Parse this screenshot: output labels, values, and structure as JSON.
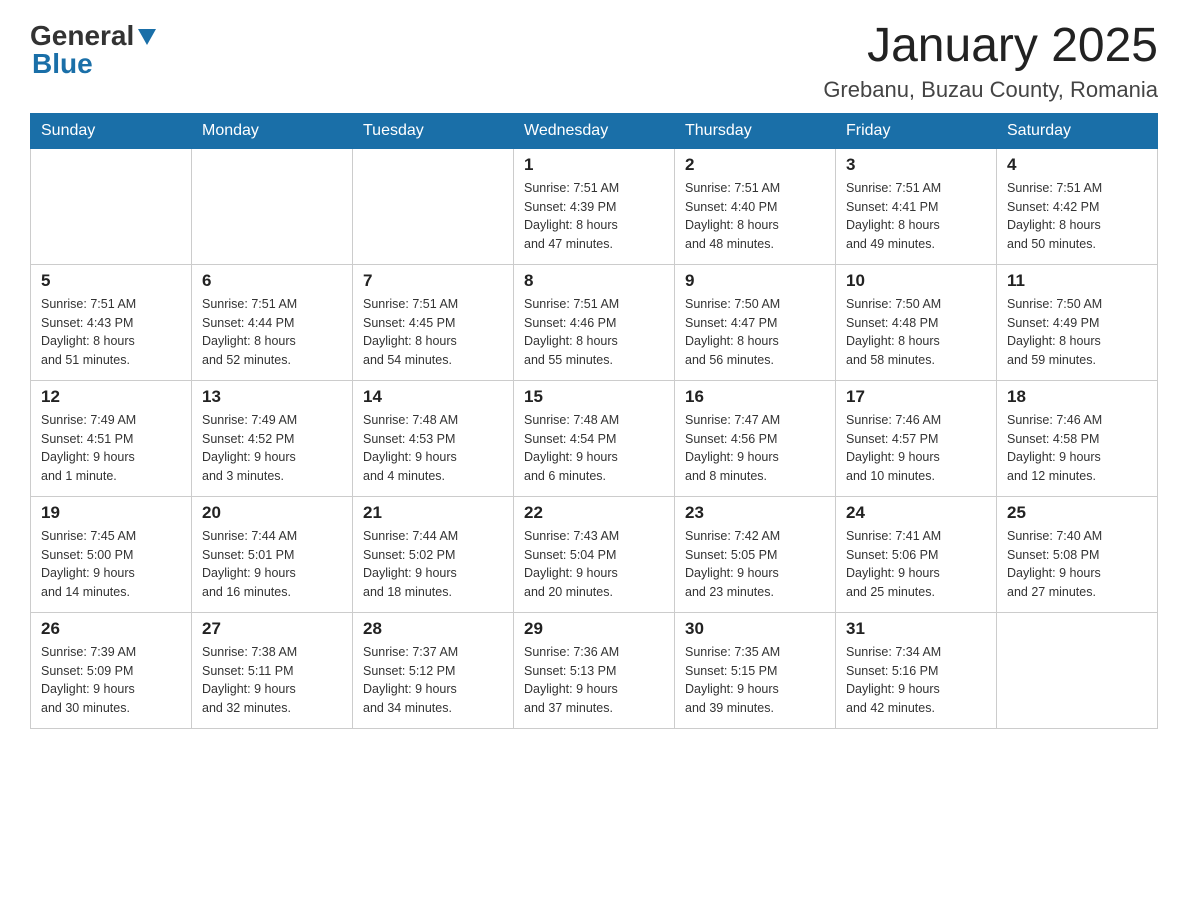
{
  "header": {
    "logo": {
      "general": "General",
      "blue": "Blue"
    },
    "title": "January 2025",
    "location": "Grebanu, Buzau County, Romania"
  },
  "weekdays": [
    "Sunday",
    "Monday",
    "Tuesday",
    "Wednesday",
    "Thursday",
    "Friday",
    "Saturday"
  ],
  "weeks": [
    [
      {
        "day": "",
        "info": ""
      },
      {
        "day": "",
        "info": ""
      },
      {
        "day": "",
        "info": ""
      },
      {
        "day": "1",
        "info": "Sunrise: 7:51 AM\nSunset: 4:39 PM\nDaylight: 8 hours\nand 47 minutes."
      },
      {
        "day": "2",
        "info": "Sunrise: 7:51 AM\nSunset: 4:40 PM\nDaylight: 8 hours\nand 48 minutes."
      },
      {
        "day": "3",
        "info": "Sunrise: 7:51 AM\nSunset: 4:41 PM\nDaylight: 8 hours\nand 49 minutes."
      },
      {
        "day": "4",
        "info": "Sunrise: 7:51 AM\nSunset: 4:42 PM\nDaylight: 8 hours\nand 50 minutes."
      }
    ],
    [
      {
        "day": "5",
        "info": "Sunrise: 7:51 AM\nSunset: 4:43 PM\nDaylight: 8 hours\nand 51 minutes."
      },
      {
        "day": "6",
        "info": "Sunrise: 7:51 AM\nSunset: 4:44 PM\nDaylight: 8 hours\nand 52 minutes."
      },
      {
        "day": "7",
        "info": "Sunrise: 7:51 AM\nSunset: 4:45 PM\nDaylight: 8 hours\nand 54 minutes."
      },
      {
        "day": "8",
        "info": "Sunrise: 7:51 AM\nSunset: 4:46 PM\nDaylight: 8 hours\nand 55 minutes."
      },
      {
        "day": "9",
        "info": "Sunrise: 7:50 AM\nSunset: 4:47 PM\nDaylight: 8 hours\nand 56 minutes."
      },
      {
        "day": "10",
        "info": "Sunrise: 7:50 AM\nSunset: 4:48 PM\nDaylight: 8 hours\nand 58 minutes."
      },
      {
        "day": "11",
        "info": "Sunrise: 7:50 AM\nSunset: 4:49 PM\nDaylight: 8 hours\nand 59 minutes."
      }
    ],
    [
      {
        "day": "12",
        "info": "Sunrise: 7:49 AM\nSunset: 4:51 PM\nDaylight: 9 hours\nand 1 minute."
      },
      {
        "day": "13",
        "info": "Sunrise: 7:49 AM\nSunset: 4:52 PM\nDaylight: 9 hours\nand 3 minutes."
      },
      {
        "day": "14",
        "info": "Sunrise: 7:48 AM\nSunset: 4:53 PM\nDaylight: 9 hours\nand 4 minutes."
      },
      {
        "day": "15",
        "info": "Sunrise: 7:48 AM\nSunset: 4:54 PM\nDaylight: 9 hours\nand 6 minutes."
      },
      {
        "day": "16",
        "info": "Sunrise: 7:47 AM\nSunset: 4:56 PM\nDaylight: 9 hours\nand 8 minutes."
      },
      {
        "day": "17",
        "info": "Sunrise: 7:46 AM\nSunset: 4:57 PM\nDaylight: 9 hours\nand 10 minutes."
      },
      {
        "day": "18",
        "info": "Sunrise: 7:46 AM\nSunset: 4:58 PM\nDaylight: 9 hours\nand 12 minutes."
      }
    ],
    [
      {
        "day": "19",
        "info": "Sunrise: 7:45 AM\nSunset: 5:00 PM\nDaylight: 9 hours\nand 14 minutes."
      },
      {
        "day": "20",
        "info": "Sunrise: 7:44 AM\nSunset: 5:01 PM\nDaylight: 9 hours\nand 16 minutes."
      },
      {
        "day": "21",
        "info": "Sunrise: 7:44 AM\nSunset: 5:02 PM\nDaylight: 9 hours\nand 18 minutes."
      },
      {
        "day": "22",
        "info": "Sunrise: 7:43 AM\nSunset: 5:04 PM\nDaylight: 9 hours\nand 20 minutes."
      },
      {
        "day": "23",
        "info": "Sunrise: 7:42 AM\nSunset: 5:05 PM\nDaylight: 9 hours\nand 23 minutes."
      },
      {
        "day": "24",
        "info": "Sunrise: 7:41 AM\nSunset: 5:06 PM\nDaylight: 9 hours\nand 25 minutes."
      },
      {
        "day": "25",
        "info": "Sunrise: 7:40 AM\nSunset: 5:08 PM\nDaylight: 9 hours\nand 27 minutes."
      }
    ],
    [
      {
        "day": "26",
        "info": "Sunrise: 7:39 AM\nSunset: 5:09 PM\nDaylight: 9 hours\nand 30 minutes."
      },
      {
        "day": "27",
        "info": "Sunrise: 7:38 AM\nSunset: 5:11 PM\nDaylight: 9 hours\nand 32 minutes."
      },
      {
        "day": "28",
        "info": "Sunrise: 7:37 AM\nSunset: 5:12 PM\nDaylight: 9 hours\nand 34 minutes."
      },
      {
        "day": "29",
        "info": "Sunrise: 7:36 AM\nSunset: 5:13 PM\nDaylight: 9 hours\nand 37 minutes."
      },
      {
        "day": "30",
        "info": "Sunrise: 7:35 AM\nSunset: 5:15 PM\nDaylight: 9 hours\nand 39 minutes."
      },
      {
        "day": "31",
        "info": "Sunrise: 7:34 AM\nSunset: 5:16 PM\nDaylight: 9 hours\nand 42 minutes."
      },
      {
        "day": "",
        "info": ""
      }
    ]
  ]
}
